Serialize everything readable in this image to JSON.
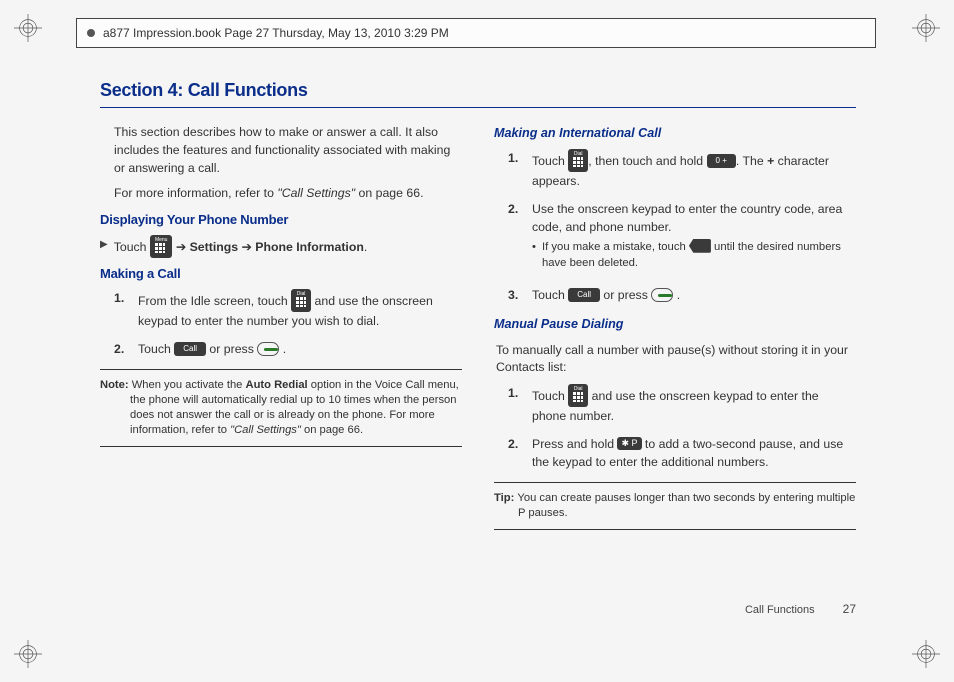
{
  "meta": {
    "header_line": "a877 Impression.book  Page 27  Thursday, May 13, 2010  3:29 PM"
  },
  "title": "Section 4: Call Functions",
  "left": {
    "intro1": "This section describes how to make or answer a call. It also includes the features and functionality associated with making or answering a call.",
    "intro2a": "For more information, refer to ",
    "intro2b": "\"Call Settings\"",
    "intro2c": "  on page 66.",
    "h_display": "Displaying Your Phone Number",
    "bullet_touch": "Touch ",
    "arrow": " ➔ ",
    "settings": "Settings",
    "phone_info": "Phone Information",
    "period": ".",
    "h_making": "Making a Call",
    "step1a": "From the Idle screen, touch ",
    "step1b": " and use the onscreen keypad to enter the number you wish to dial.",
    "step2a": "Touch ",
    "step2b": " or press ",
    "step2c": " .",
    "note_label": "Note: ",
    "note_body_a": "When you activate the ",
    "note_bold": "Auto Redial",
    "note_body_b": " option in the Voice Call menu, the phone will automatically redial up to 10 times when the person does not answer the call or is already on the phone. For more information, refer to ",
    "note_ref": "\"Call Settings\"",
    "note_body_c": "  on page 66.",
    "call_label": "Call",
    "dial_label": "Dial",
    "menu_label": "Menu"
  },
  "right": {
    "h_intl": "Making an International Call",
    "s1a": "Touch ",
    "s1b": ", then touch and hold ",
    "zero_plus": "0 +",
    "s1c": ". The ",
    "plus": "+",
    "s1d": " character appears.",
    "s2": "Use the onscreen keypad to enter the country code, area code, and phone number.",
    "s2_bullet_a": "If you make a mistake, touch ",
    "s2_bullet_b": " until the desired numbers have been deleted.",
    "s3a": "Touch ",
    "s3b": " or press ",
    "s3c": " .",
    "h_manual": "Manual Pause Dialing",
    "mp_intro": "To manually call a number with pause(s) without storing it in your Contacts list:",
    "mp1a": "Touch ",
    "mp1b": " and use the onscreen keypad to enter the phone number.",
    "mp2a": "Press and hold ",
    "mp2b": " to add a two-second pause, and use the keypad to enter the additional numbers.",
    "star_p": "P",
    "tip_label": "Tip: ",
    "tip_body": "You can create pauses longer than two seconds by entering multiple P pauses.",
    "call_label": "Call",
    "dial_label": "Dial"
  },
  "footer": {
    "section": "Call Functions",
    "page": "27"
  },
  "nums": {
    "n1": "1.",
    "n2": "2.",
    "n3": "3."
  }
}
